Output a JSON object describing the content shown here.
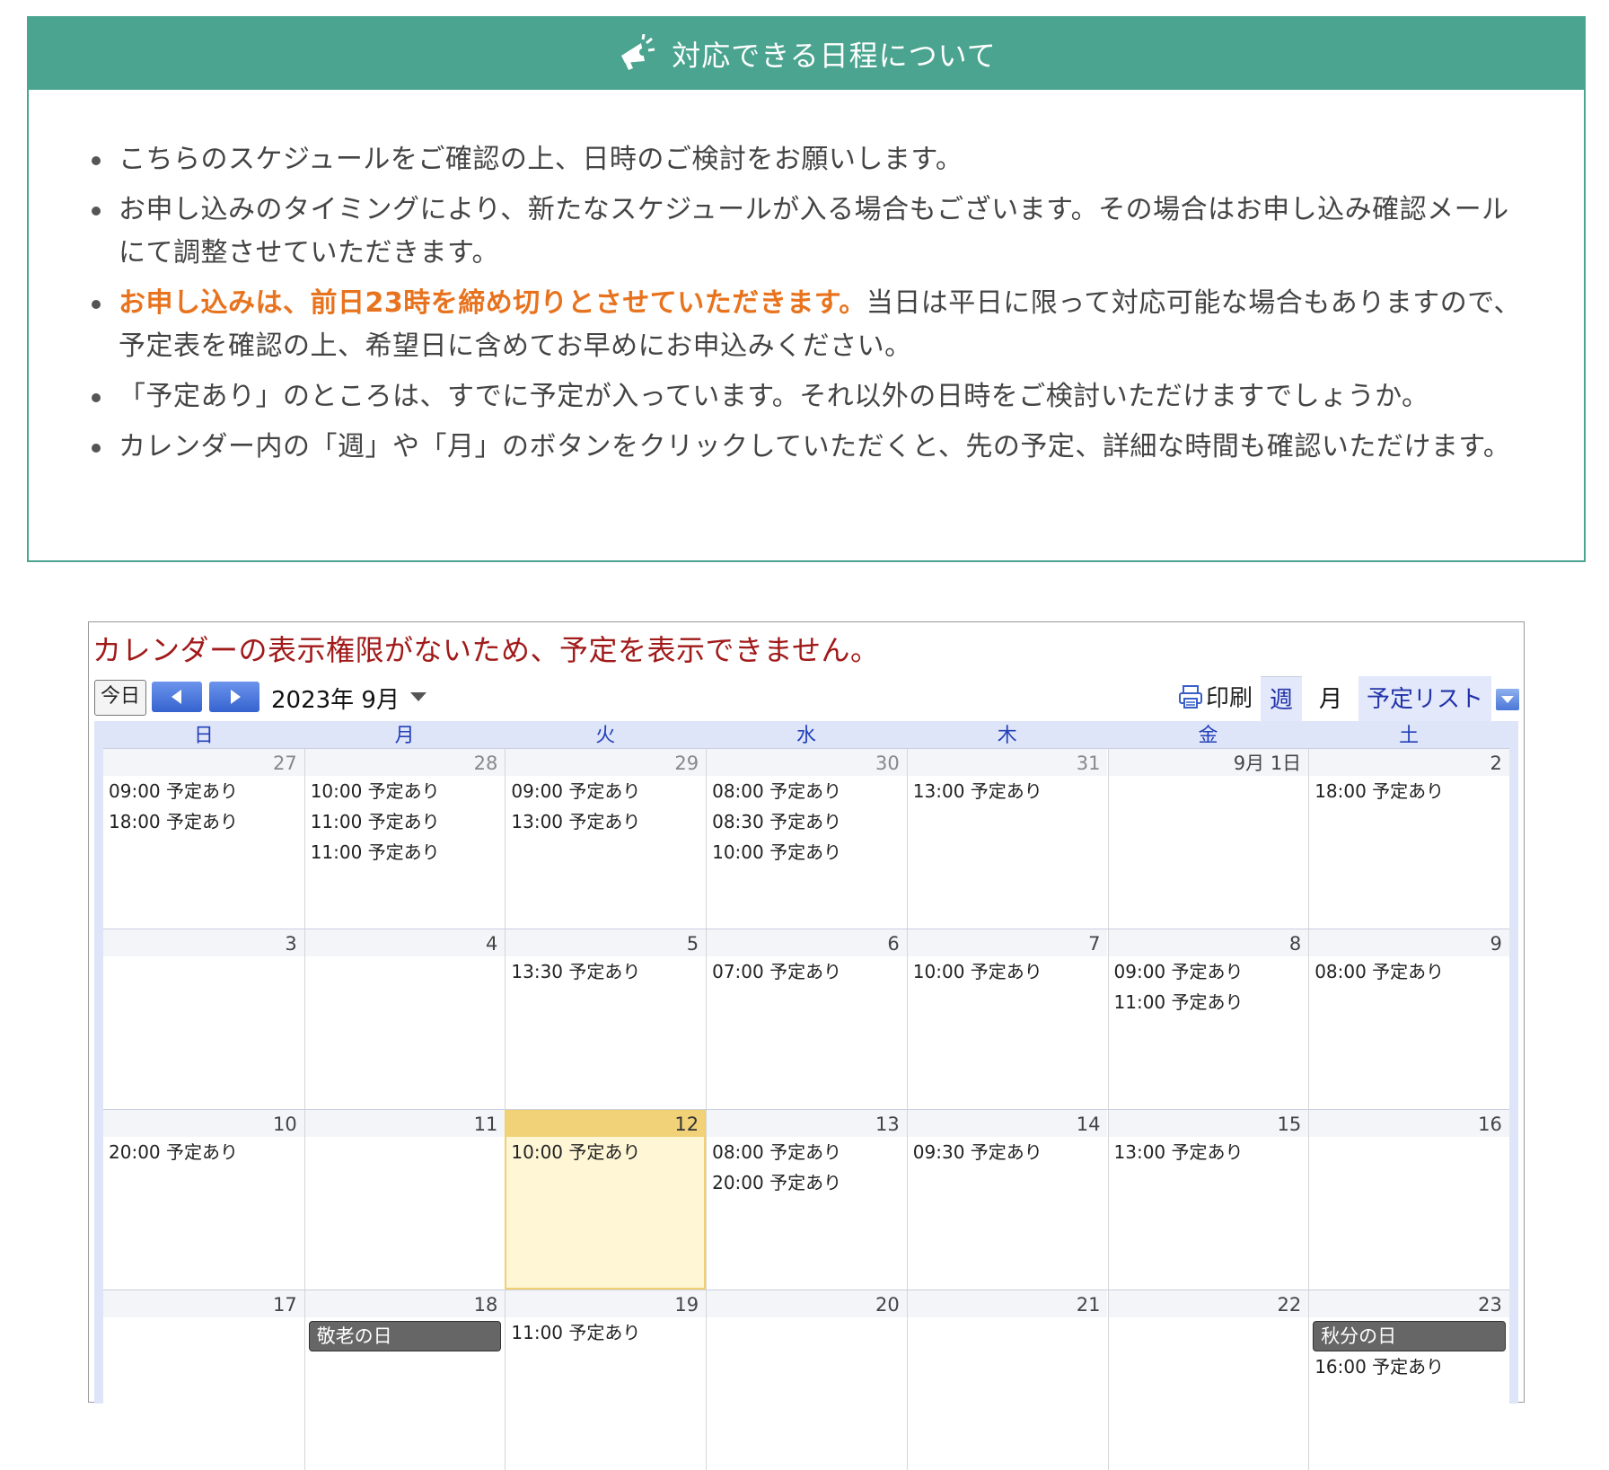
{
  "notice": {
    "title": "対応できる日程について",
    "items": [
      "こちらのスケジュールをご確認の上、日時のご検討をお願いします。",
      "お申し込みのタイミングにより、新たなスケジュールが入る場合もございます。その場合はお申し込み確認メールにて調整させていただきます。",
      "「予定あり」のところは、すでに予定が入っています。それ以外の日時をご検討いただけますでしょうか。",
      "カレンダー内の「週」や「月」のボタンをクリックしていただくと、先の予定、詳細な時間も確認いただけます。"
    ],
    "highlight_item": {
      "highlight": "お申し込みは、前日23時を締め切りとさせていただきます。",
      "rest": "当日は平日に限って対応可能な場合もありますので、予定表を確認の上、希望日に含めてお早めにお申込みください。"
    },
    "colors": {
      "header_bg": "#4aa48f",
      "highlight": "#e8731e"
    },
    "icon": "megaphone-icon"
  },
  "calendar": {
    "error": "カレンダーの表示権限がないため、予定を表示できません。",
    "today_label": "今日",
    "month_title": "2023年 9月",
    "print_label": "印刷",
    "tabs": {
      "week": "週",
      "month": "月",
      "agenda": "予定リスト"
    },
    "weekdays": [
      "日",
      "月",
      "火",
      "水",
      "木",
      "金",
      "土"
    ],
    "weeks": [
      [
        {
          "day": "27",
          "other": true,
          "events": [
            "09:00 予定あり",
            "18:00 予定あり"
          ]
        },
        {
          "day": "28",
          "other": true,
          "events": [
            "10:00 予定あり",
            "11:00 予定あり",
            "11:00 予定あり"
          ]
        },
        {
          "day": "29",
          "other": true,
          "events": [
            "09:00 予定あり",
            "13:00 予定あり"
          ]
        },
        {
          "day": "30",
          "other": true,
          "events": [
            "08:00 予定あり",
            "08:30 予定あり",
            "10:00 予定あり"
          ]
        },
        {
          "day": "31",
          "other": true,
          "events": [
            "13:00 予定あり"
          ]
        },
        {
          "day": "9月 1日",
          "events": []
        },
        {
          "day": "2",
          "events": [
            "18:00 予定あり"
          ]
        }
      ],
      [
        {
          "day": "3",
          "events": []
        },
        {
          "day": "4",
          "events": []
        },
        {
          "day": "5",
          "events": [
            "13:30 予定あり"
          ]
        },
        {
          "day": "6",
          "events": [
            "07:00 予定あり"
          ]
        },
        {
          "day": "7",
          "events": [
            "10:00 予定あり"
          ]
        },
        {
          "day": "8",
          "events": [
            "09:00 予定あり",
            "11:00 予定あり"
          ]
        },
        {
          "day": "9",
          "events": [
            "08:00 予定あり"
          ]
        }
      ],
      [
        {
          "day": "10",
          "events": [
            "20:00 予定あり"
          ]
        },
        {
          "day": "11",
          "events": []
        },
        {
          "day": "12",
          "today": true,
          "events": [
            "10:00 予定あり"
          ]
        },
        {
          "day": "13",
          "events": [
            "08:00 予定あり",
            "20:00 予定あり"
          ]
        },
        {
          "day": "14",
          "events": [
            "09:30 予定あり"
          ]
        },
        {
          "day": "15",
          "events": [
            "13:00 予定あり"
          ]
        },
        {
          "day": "16",
          "events": []
        }
      ],
      [
        {
          "day": "17",
          "events": []
        },
        {
          "day": "18",
          "holiday": "敬老の日",
          "events": []
        },
        {
          "day": "19",
          "events": [
            "11:00 予定あり"
          ]
        },
        {
          "day": "20",
          "events": []
        },
        {
          "day": "21",
          "events": []
        },
        {
          "day": "22",
          "events": []
        },
        {
          "day": "23",
          "holiday": "秋分の日",
          "events": [
            "16:00 予定あり"
          ]
        }
      ]
    ]
  }
}
